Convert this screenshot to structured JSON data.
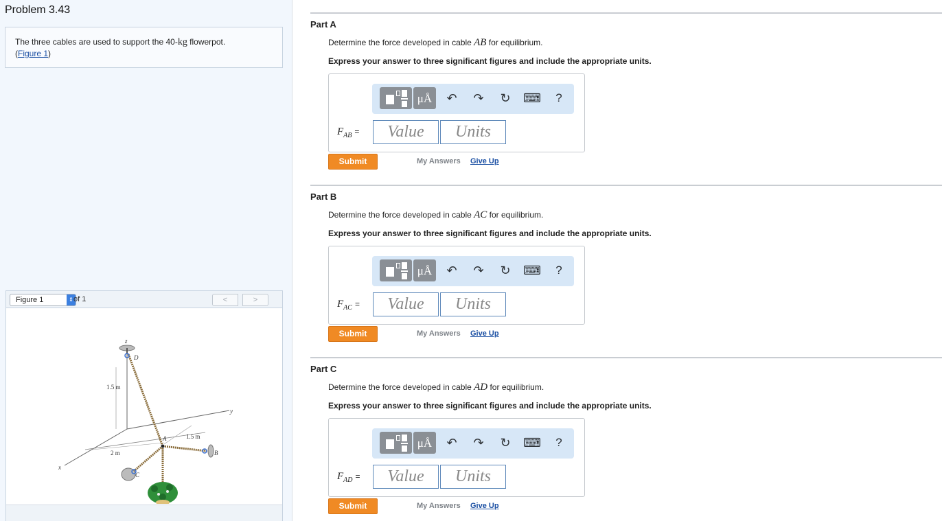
{
  "problem": {
    "title": "Problem 3.43",
    "text_before": "The three cables are used to support the 40-",
    "text_unit": "kg",
    "text_after": " flowerpot.",
    "figure_link_open": "(",
    "figure_link": "Figure 1",
    "figure_link_close": ")"
  },
  "figure": {
    "select_label": "Figure 1",
    "of_label": "of 1",
    "prev": "<",
    "next": ">",
    "labels": {
      "z": "z",
      "y": "y",
      "x": "x",
      "A": "A",
      "B": "B",
      "C": "C",
      "D": "D",
      "dim_vertical": "1.5 m",
      "dim_ab": "1.5 m",
      "dim_x": "2 m"
    }
  },
  "toolbar": {
    "mu": "μÅ",
    "undo": "↶",
    "redo": "↷",
    "reset": "↻",
    "keyboard": "⌨",
    "help": "?"
  },
  "parts": [
    {
      "title": "Part A",
      "q_before": "Determine the force developed in cable ",
      "cable": "AB",
      "q_after": " for equilibrium.",
      "instruction": "Express your answer to three significant figures and include the appropriate units.",
      "f_var": "F",
      "f_sub": "AB",
      "eq": "=",
      "value_placeholder": "Value",
      "units_placeholder": "Units",
      "submit": "Submit",
      "my_answers": "My Answers",
      "give_up": "Give Up"
    },
    {
      "title": "Part B",
      "q_before": "Determine the force developed in cable ",
      "cable": "AC",
      "q_after": " for equilibrium.",
      "instruction": "Express your answer to three significant figures and include the appropriate units.",
      "f_var": "F",
      "f_sub": "AC",
      "eq": "=",
      "value_placeholder": "Value",
      "units_placeholder": "Units",
      "submit": "Submit",
      "my_answers": "My Answers",
      "give_up": "Give Up"
    },
    {
      "title": "Part C",
      "q_before": "Determine the force developed in cable ",
      "cable": "AD",
      "q_after": " for equilibrium.",
      "instruction": "Express your answer to three significant figures and include the appropriate units.",
      "f_var": "F",
      "f_sub": "AD",
      "eq": "=",
      "value_placeholder": "Value",
      "units_placeholder": "Units",
      "submit": "Submit",
      "my_answers": "My Answers",
      "give_up": "Give Up"
    }
  ]
}
